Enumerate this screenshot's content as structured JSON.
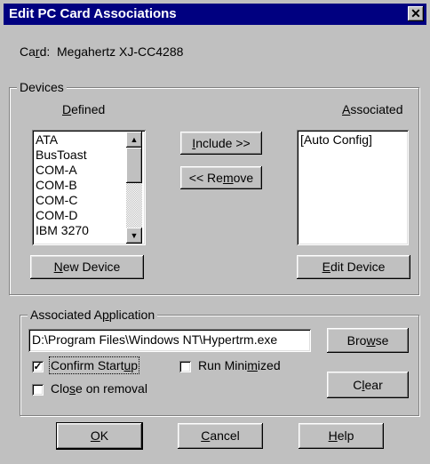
{
  "window": {
    "title": "Edit PC Card Associations",
    "close_glyph": "✕"
  },
  "card": {
    "label": "Card:",
    "value": "Megahertz XJ-CC4288"
  },
  "devices": {
    "group_title": "Devices",
    "defined_label": "Defined",
    "associated_label": "Associated",
    "defined_items": [
      "ATA",
      "BusToast",
      "COM-A",
      "COM-B",
      "COM-C",
      "COM-D",
      "IBM 3270"
    ],
    "associated_items": [
      "[Auto Config]"
    ],
    "include_button": "Include >>",
    "remove_button": "<< Remove",
    "new_device_button": "New Device",
    "edit_device_button": "Edit Device"
  },
  "application": {
    "group_title": "Associated Application",
    "path_value": "D:\\Program Files\\Windows NT\\Hypertrm.exe",
    "browse_button": "Browse",
    "clear_button": "Clear",
    "confirm_startup": {
      "label": "Confirm Startup",
      "checked": true
    },
    "run_minimized": {
      "label": "Run Minimized",
      "checked": false
    },
    "close_on_removal": {
      "label": "Close on removal",
      "checked": false
    }
  },
  "footer": {
    "ok_button": "OK",
    "cancel_button": "Cancel",
    "help_button": "Help"
  }
}
